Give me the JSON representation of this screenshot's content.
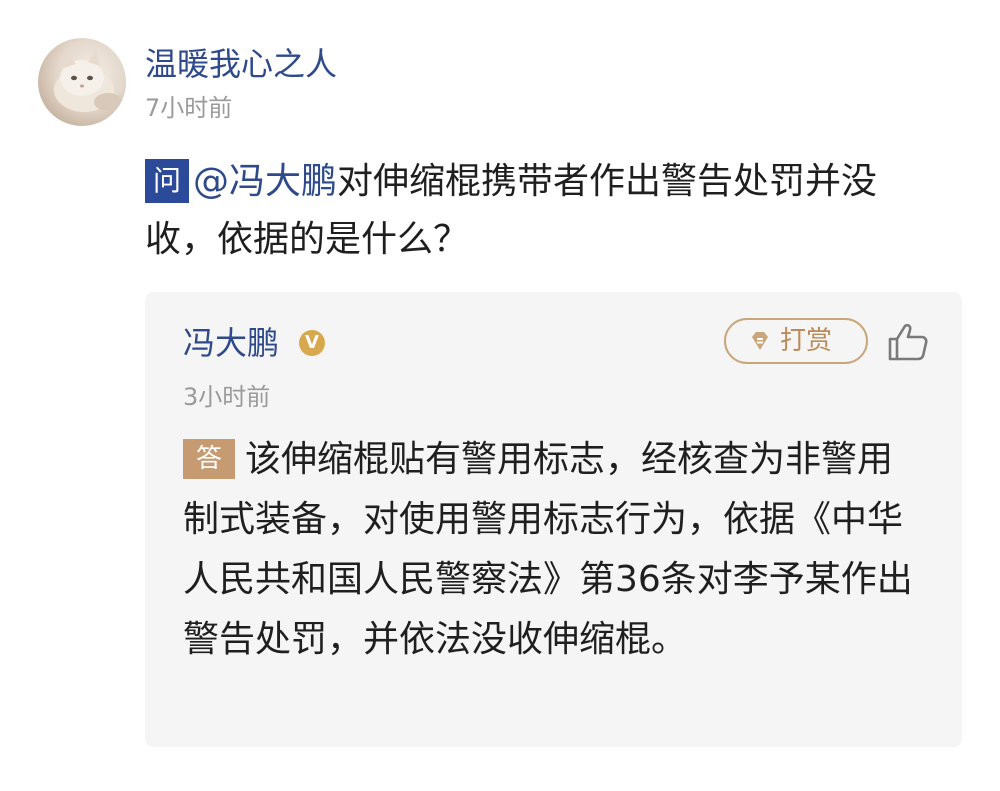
{
  "question": {
    "asker_name": "温暖我心之人",
    "time": "7小时前",
    "badge": "问",
    "mention": "@冯大鹏",
    "text": "对伸缩棍携带者作出警告处罚并没收，依据的是什么？"
  },
  "answer": {
    "answerer_name": "冯大鹏",
    "verified_badge": "V",
    "tip_label": "打赏",
    "time": "3小时前",
    "badge": "答",
    "text": "该伸缩棍贴有警用标志，经核查为非警用制式装备，对使用警用标志行为，依据《中华人民共和国人民警察法》第36条对李予某作出警告处罚，并依法没收伸缩棍。"
  },
  "icons": {
    "avatar": "cat-avatar",
    "verified": "verified-v-icon",
    "tip": "gem-icon",
    "like": "thumbs-up-icon"
  },
  "colors": {
    "link_blue": "#2e4a8b",
    "question_badge": "#2b4a9a",
    "answer_badge": "#c79b72",
    "tip_gold": "#c9a57a",
    "verified_gold": "#d7a84d",
    "muted_text": "#9a9a9a",
    "card_bg": "#f5f5f5"
  }
}
